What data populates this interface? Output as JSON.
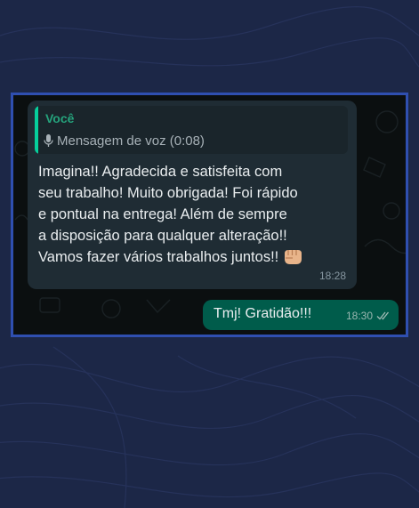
{
  "chat": {
    "incoming": {
      "quote": {
        "author": "Você",
        "text": "Mensagem de voz (0:08)",
        "icon": "mic-icon"
      },
      "lines": [
        "Imagina!! Agradecida e satisfeita com",
        "seu trabalho! Muito obrigada! Foi rápido",
        "e pontual na entrega! Além de sempre",
        "a disposição para qualquer alteração!!",
        "Vamos fazer vários trabalhos juntos!!"
      ],
      "emoji": "fist-bump-icon",
      "time": "18:28"
    },
    "outgoing": {
      "text": "Tmj! Gratidão!!!",
      "time": "18:30",
      "status_icon": "double-check-icon"
    }
  },
  "colors": {
    "background": "#1c2747",
    "frame_border": "#2f4fb0",
    "incoming_bubble": "#1f2c34",
    "outgoing_bubble": "#005c4b",
    "quote_accent": "#06cf9c"
  }
}
